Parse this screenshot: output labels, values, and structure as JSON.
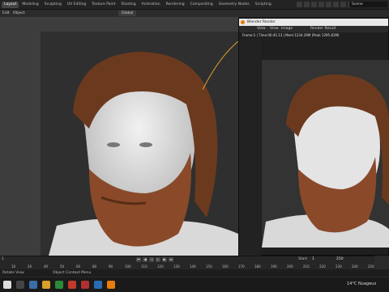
{
  "workspace_tabs": [
    "Layout",
    "Modeling",
    "Sculpting",
    "UV Editing",
    "Texture Paint",
    "Shading",
    "Animation",
    "Rendering",
    "Compositing",
    "Geometry Nodes",
    "Scripting"
  ],
  "active_tab_index": 0,
  "scene_label": "Scene",
  "header": {
    "edit_label": "Edit",
    "object_label": "Object",
    "transform_label": "Global"
  },
  "render_window": {
    "title": "Blender Render",
    "menu": {
      "view": "View",
      "view2": "View",
      "image": "Image",
      "slot": "Render Result"
    },
    "info_text": "Frame:1 | Time:00:45.13 | Mem:1234.26M (Peak 1295.81M)"
  },
  "timeline": {
    "ticks": [
      "10",
      "20",
      "40",
      "50",
      "60",
      "80",
      "90",
      "100",
      "110",
      "120",
      "130",
      "140",
      "150",
      "160",
      "170",
      "180",
      "190",
      "200",
      "210",
      "220",
      "230",
      "240",
      "250"
    ],
    "start_label": "Start",
    "start_value": "1",
    "end_value": "250",
    "frame_label": "1"
  },
  "statusbar": {
    "left": "Rotate View",
    "mid": "Object Context Menu"
  },
  "taskbar": {
    "weather": "14°C  Nuageux"
  },
  "colors": {
    "accent": "#e87d0d",
    "hair": "#6b3a1e",
    "beard": "#8a4a2a",
    "skin": "#d8d8d8"
  }
}
